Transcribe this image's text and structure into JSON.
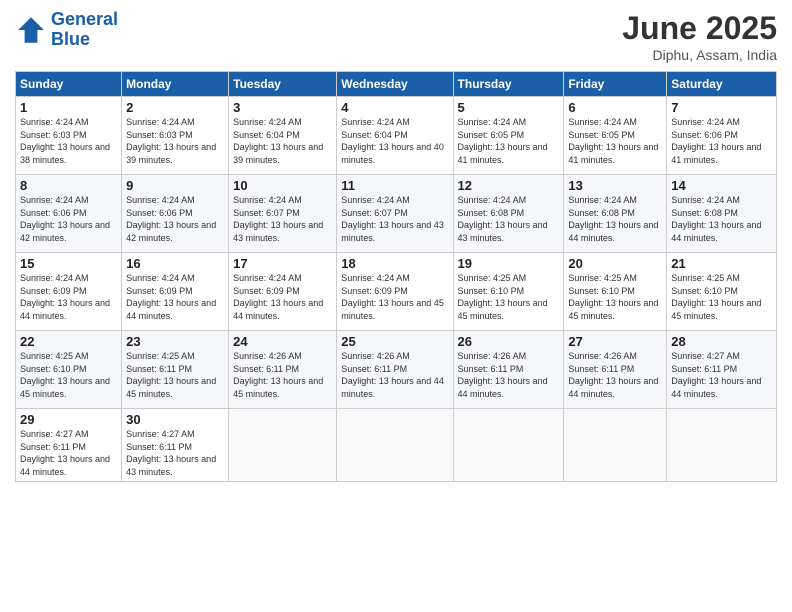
{
  "logo": {
    "line1": "General",
    "line2": "Blue"
  },
  "title": "June 2025",
  "subtitle": "Diphu, Assam, India",
  "weekdays": [
    "Sunday",
    "Monday",
    "Tuesday",
    "Wednesday",
    "Thursday",
    "Friday",
    "Saturday"
  ],
  "weeks": [
    [
      {
        "day": "1",
        "sunrise": "4:24 AM",
        "sunset": "6:03 PM",
        "daylight": "13 hours and 38 minutes."
      },
      {
        "day": "2",
        "sunrise": "4:24 AM",
        "sunset": "6:03 PM",
        "daylight": "13 hours and 39 minutes."
      },
      {
        "day": "3",
        "sunrise": "4:24 AM",
        "sunset": "6:04 PM",
        "daylight": "13 hours and 39 minutes."
      },
      {
        "day": "4",
        "sunrise": "4:24 AM",
        "sunset": "6:04 PM",
        "daylight": "13 hours and 40 minutes."
      },
      {
        "day": "5",
        "sunrise": "4:24 AM",
        "sunset": "6:05 PM",
        "daylight": "13 hours and 41 minutes."
      },
      {
        "day": "6",
        "sunrise": "4:24 AM",
        "sunset": "6:05 PM",
        "daylight": "13 hours and 41 minutes."
      },
      {
        "day": "7",
        "sunrise": "4:24 AM",
        "sunset": "6:06 PM",
        "daylight": "13 hours and 41 minutes."
      }
    ],
    [
      {
        "day": "8",
        "sunrise": "4:24 AM",
        "sunset": "6:06 PM",
        "daylight": "13 hours and 42 minutes."
      },
      {
        "day": "9",
        "sunrise": "4:24 AM",
        "sunset": "6:06 PM",
        "daylight": "13 hours and 42 minutes."
      },
      {
        "day": "10",
        "sunrise": "4:24 AM",
        "sunset": "6:07 PM",
        "daylight": "13 hours and 43 minutes."
      },
      {
        "day": "11",
        "sunrise": "4:24 AM",
        "sunset": "6:07 PM",
        "daylight": "13 hours and 43 minutes."
      },
      {
        "day": "12",
        "sunrise": "4:24 AM",
        "sunset": "6:08 PM",
        "daylight": "13 hours and 43 minutes."
      },
      {
        "day": "13",
        "sunrise": "4:24 AM",
        "sunset": "6:08 PM",
        "daylight": "13 hours and 44 minutes."
      },
      {
        "day": "14",
        "sunrise": "4:24 AM",
        "sunset": "6:08 PM",
        "daylight": "13 hours and 44 minutes."
      }
    ],
    [
      {
        "day": "15",
        "sunrise": "4:24 AM",
        "sunset": "6:09 PM",
        "daylight": "13 hours and 44 minutes."
      },
      {
        "day": "16",
        "sunrise": "4:24 AM",
        "sunset": "6:09 PM",
        "daylight": "13 hours and 44 minutes."
      },
      {
        "day": "17",
        "sunrise": "4:24 AM",
        "sunset": "6:09 PM",
        "daylight": "13 hours and 44 minutes."
      },
      {
        "day": "18",
        "sunrise": "4:24 AM",
        "sunset": "6:09 PM",
        "daylight": "13 hours and 45 minutes."
      },
      {
        "day": "19",
        "sunrise": "4:25 AM",
        "sunset": "6:10 PM",
        "daylight": "13 hours and 45 minutes."
      },
      {
        "day": "20",
        "sunrise": "4:25 AM",
        "sunset": "6:10 PM",
        "daylight": "13 hours and 45 minutes."
      },
      {
        "day": "21",
        "sunrise": "4:25 AM",
        "sunset": "6:10 PM",
        "daylight": "13 hours and 45 minutes."
      }
    ],
    [
      {
        "day": "22",
        "sunrise": "4:25 AM",
        "sunset": "6:10 PM",
        "daylight": "13 hours and 45 minutes."
      },
      {
        "day": "23",
        "sunrise": "4:25 AM",
        "sunset": "6:11 PM",
        "daylight": "13 hours and 45 minutes."
      },
      {
        "day": "24",
        "sunrise": "4:26 AM",
        "sunset": "6:11 PM",
        "daylight": "13 hours and 45 minutes."
      },
      {
        "day": "25",
        "sunrise": "4:26 AM",
        "sunset": "6:11 PM",
        "daylight": "13 hours and 44 minutes."
      },
      {
        "day": "26",
        "sunrise": "4:26 AM",
        "sunset": "6:11 PM",
        "daylight": "13 hours and 44 minutes."
      },
      {
        "day": "27",
        "sunrise": "4:26 AM",
        "sunset": "6:11 PM",
        "daylight": "13 hours and 44 minutes."
      },
      {
        "day": "28",
        "sunrise": "4:27 AM",
        "sunset": "6:11 PM",
        "daylight": "13 hours and 44 minutes."
      }
    ],
    [
      {
        "day": "29",
        "sunrise": "4:27 AM",
        "sunset": "6:11 PM",
        "daylight": "13 hours and 44 minutes."
      },
      {
        "day": "30",
        "sunrise": "4:27 AM",
        "sunset": "6:11 PM",
        "daylight": "13 hours and 43 minutes."
      },
      null,
      null,
      null,
      null,
      null
    ]
  ]
}
